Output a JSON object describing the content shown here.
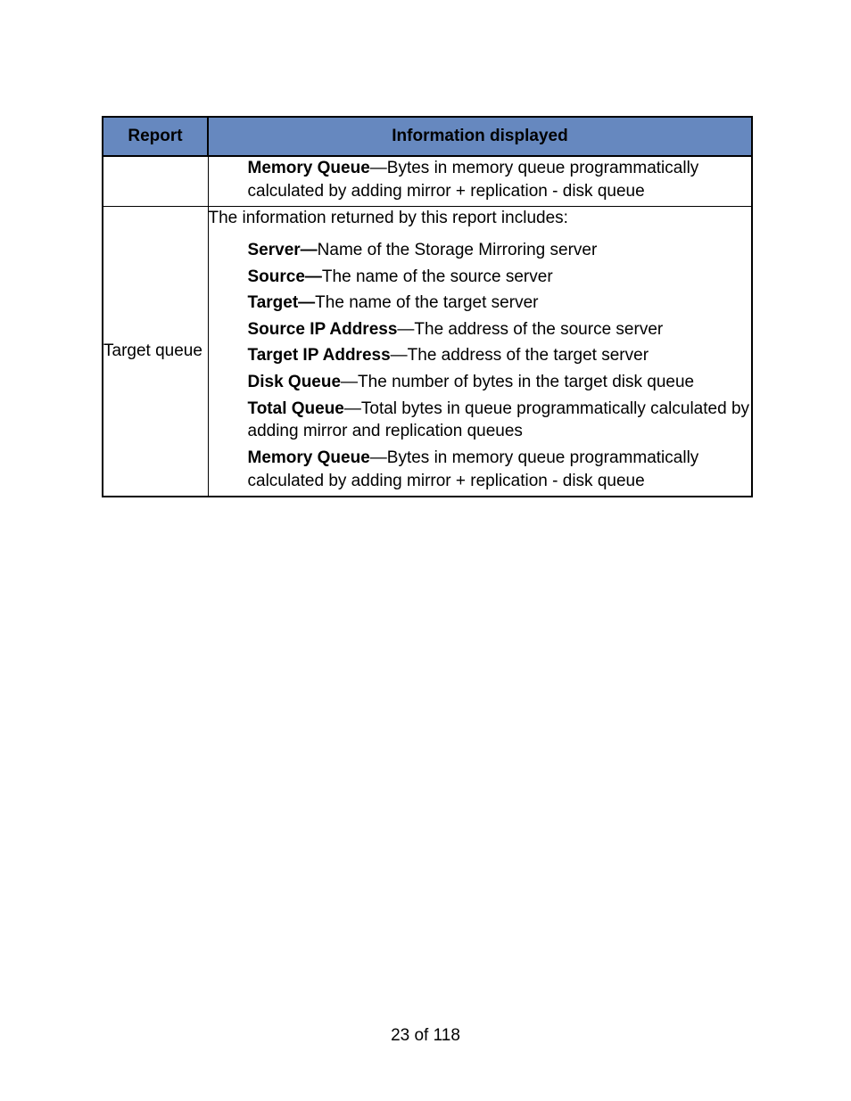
{
  "table": {
    "headers": {
      "report": "Report",
      "info": "Information displayed"
    },
    "rows": [
      {
        "label": "",
        "intro": "",
        "items": [
          {
            "term": "Memory Queue",
            "desc": "—Bytes in memory queue programmatically calculated by adding mirror + replication - disk queue"
          }
        ]
      },
      {
        "label": "Target queue",
        "intro": "The information returned by this report includes:",
        "items": [
          {
            "term": "Server—",
            "desc": "Name of the Storage Mirroring server"
          },
          {
            "term": "Source—",
            "desc": "The name of the source server"
          },
          {
            "term": "Target—",
            "desc": "The name of the target server"
          },
          {
            "term": "Source IP Address",
            "desc": "—The address of the source server"
          },
          {
            "term": "Target IP Address",
            "desc": "—The address of the target server"
          },
          {
            "term": "Disk Queue",
            "desc": "—The number of bytes in the target disk queue"
          },
          {
            "term": "Total Queue",
            "desc": "—Total bytes in queue programmatically calculated by adding mirror and replication queues"
          },
          {
            "term": "Memory Queue",
            "desc": "—Bytes in memory queue programmatically calculated by adding mirror + replication - disk queue"
          }
        ]
      }
    ]
  },
  "footer": "23 of 118"
}
